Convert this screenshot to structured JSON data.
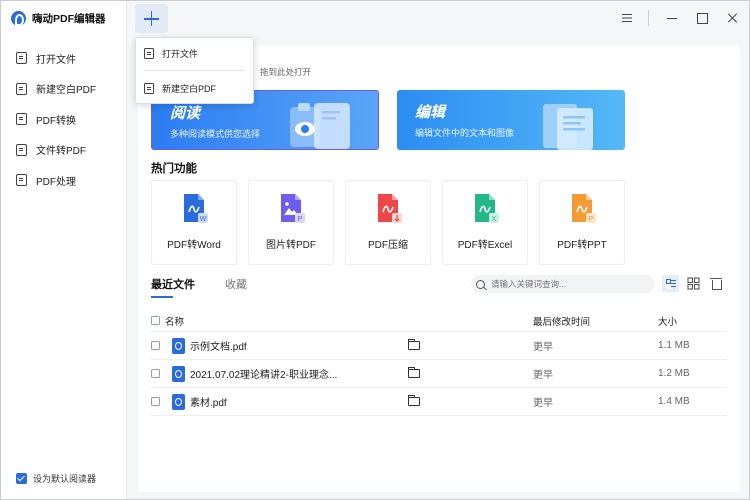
{
  "app": {
    "name": "嗨动PDF编辑器"
  },
  "sidebar": {
    "items": [
      {
        "label": "打开文件"
      },
      {
        "label": "新建空白PDF"
      },
      {
        "label": "PDF转换"
      },
      {
        "label": "文件转PDF"
      },
      {
        "label": "PDF处理"
      }
    ],
    "default_reader_label": "设为默认阅读器",
    "default_reader_checked": true
  },
  "add_menu": {
    "items": [
      {
        "label": "打开文件"
      },
      {
        "label": "新建空白PDF"
      }
    ]
  },
  "main": {
    "tip": "拖到此处打开",
    "banners": {
      "read": {
        "title": "阅读",
        "subtitle": "多种阅读模式供您选择"
      },
      "edit": {
        "title": "编辑",
        "subtitle": "编辑文件中的文本和图像"
      }
    },
    "hot_title": "热门功能",
    "tools": [
      {
        "label": "PDF转Word",
        "icon": "pdf-to-word-icon",
        "color": "#2a6be0",
        "badge": "W"
      },
      {
        "label": "图片转PDF",
        "icon": "image-to-pdf-icon",
        "color": "#6f5cf0",
        "badge": "P"
      },
      {
        "label": "PDF压缩",
        "icon": "pdf-compress-icon",
        "color": "#ef4747",
        "badge": ""
      },
      {
        "label": "PDF转Excel",
        "icon": "pdf-to-excel-icon",
        "color": "#22b889",
        "badge": "X"
      },
      {
        "label": "PDF转PPT",
        "icon": "pdf-to-ppt-icon",
        "color": "#f59a35",
        "badge": "P"
      }
    ],
    "tabs": [
      {
        "label": "最近文件"
      },
      {
        "label": "收藏"
      }
    ],
    "search_placeholder": "请输入关键词查询...",
    "table": {
      "headers": {
        "name": "名称",
        "time": "最后修改时间",
        "size": "大小"
      },
      "rows": [
        {
          "name": "示例文档.pdf",
          "time": "更早",
          "size": "1.1 MB"
        },
        {
          "name": "2021.07.02理论精讲2-职业理念...",
          "time": "更早",
          "size": "1.2 MB"
        },
        {
          "name": "素材.pdf",
          "time": "更早",
          "size": "1.4 MB"
        }
      ]
    }
  },
  "colors": {
    "accent": "#2a6be0"
  }
}
